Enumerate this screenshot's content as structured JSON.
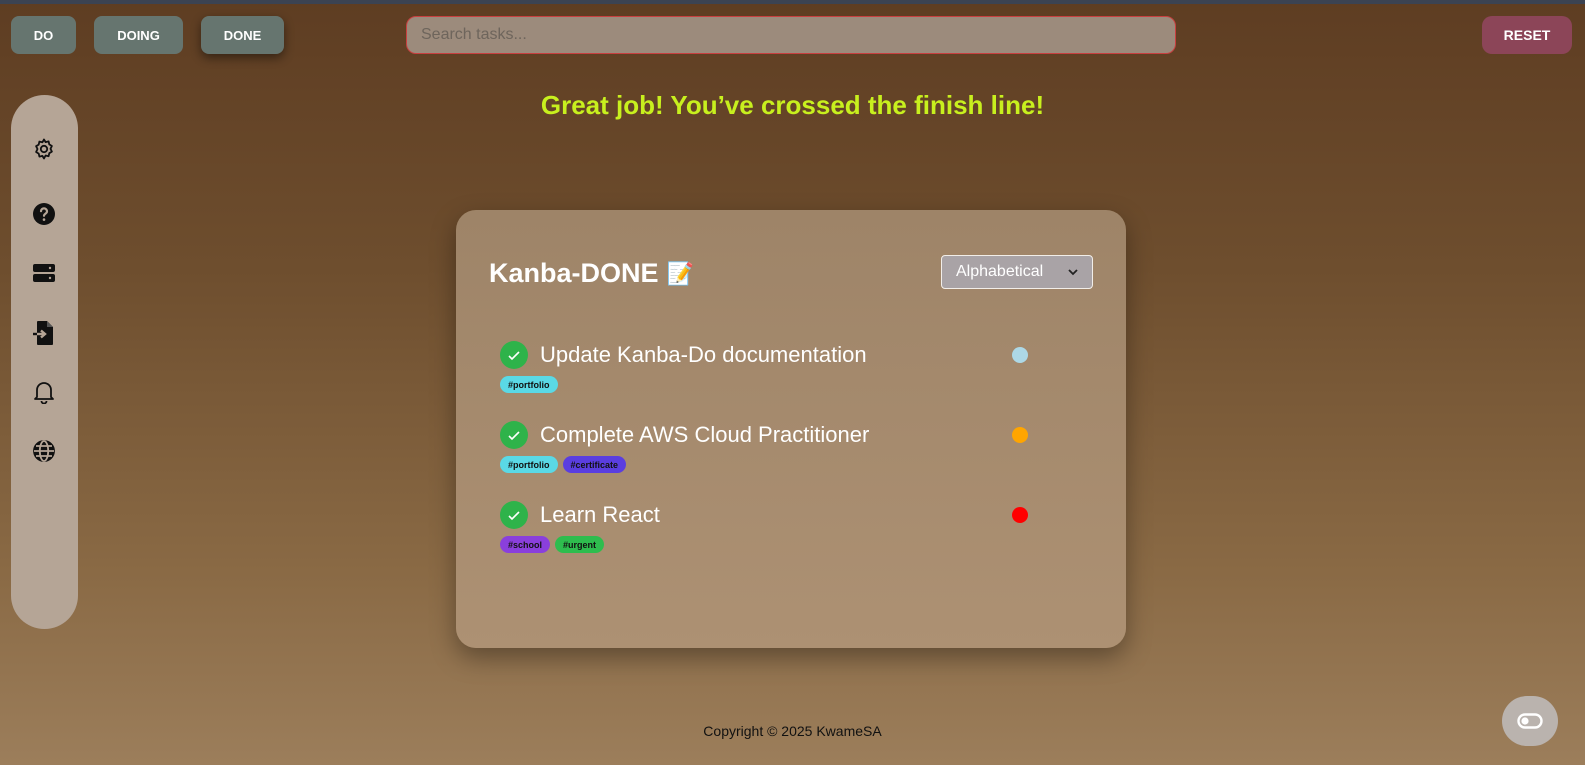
{
  "nav": {
    "do_label": "DO",
    "doing_label": "DOING",
    "done_label": "DONE",
    "active": "DONE"
  },
  "search": {
    "placeholder": "Search tasks..."
  },
  "reset_label": "RESET",
  "headline": "Great job! You’ve crossed the finish line!",
  "sidebar": {
    "icons": [
      "gear-icon",
      "help-icon",
      "storage-icon",
      "file-import-icon",
      "bell-icon",
      "globe-icon"
    ]
  },
  "board": {
    "title": "Kanba-DONE",
    "title_emoji": "📝",
    "sort_selected": "Alphabetical",
    "tasks": [
      {
        "title": "Update Kanba-Do documentation",
        "priority_color": "#add8e6",
        "tags": [
          {
            "label": "#portfolio",
            "color": "#5ad9e6"
          }
        ]
      },
      {
        "title": "Complete AWS Cloud Practitioner",
        "priority_color": "#ffa500",
        "tags": [
          {
            "label": "#portfolio",
            "color": "#5ad9e6"
          },
          {
            "label": "#certificate",
            "color": "#5a3ee0"
          }
        ]
      },
      {
        "title": "Learn React",
        "priority_color": "#ff0000",
        "tags": [
          {
            "label": "#school",
            "color": "#8a3fdc"
          },
          {
            "label": "#urgent",
            "color": "#2ebd4e"
          }
        ]
      }
    ]
  },
  "footer": "Copyright © 2025 KwameSA",
  "colors": {
    "accent_headline": "#c8f01e",
    "nav_button": "#66756f",
    "reset_button": "#8c4558",
    "check_green": "#2eb34a"
  }
}
